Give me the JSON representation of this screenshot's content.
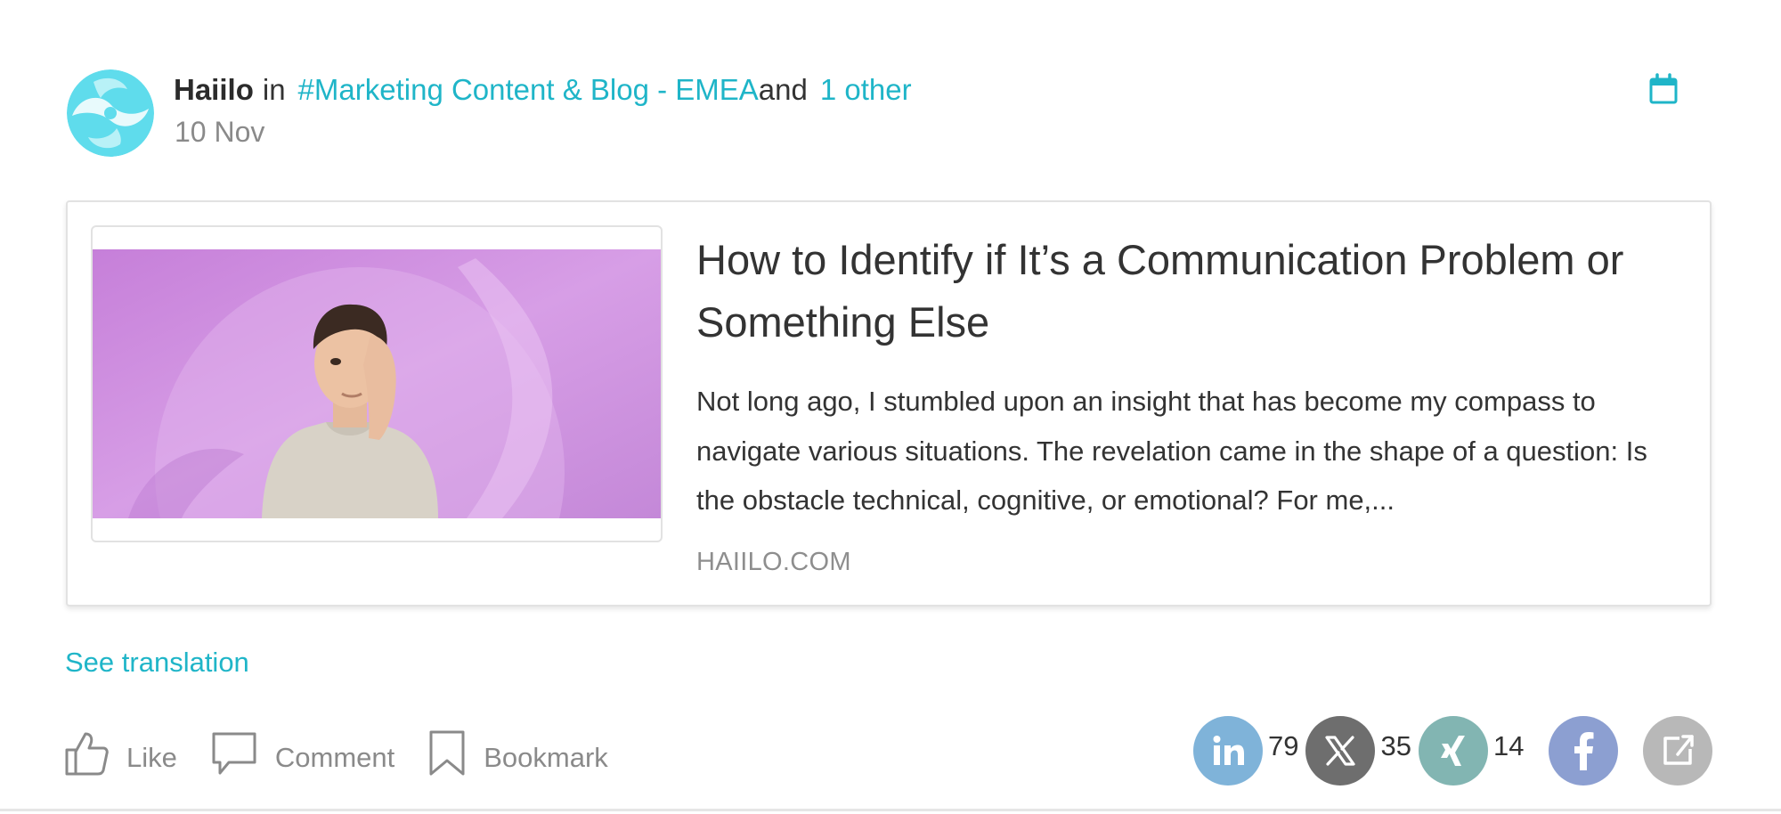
{
  "post": {
    "author": "Haiilo",
    "in_word": "in",
    "channel": "#Marketing Content & Blog - EMEA",
    "and_word": "and",
    "others": "1 other",
    "date": "10 Nov"
  },
  "preview": {
    "title": "How to Identify if It’s a Communication Problem or Something Else",
    "excerpt": "Not long ago, I stumbled upon an insight that has become my compass to navigate various situations. The revelation came in the shape of a question: Is the obstacle technical, cognitive, or emotional? For me,...",
    "domain": "HAIILO.COM"
  },
  "translation_link": "See translation",
  "actions": {
    "like": "Like",
    "comment": "Comment",
    "bookmark": "Bookmark"
  },
  "shares": {
    "linkedin": "79",
    "x": "35",
    "xing": "14"
  },
  "colors": {
    "accent": "#1fb5c8",
    "linkedin": "#7fb3d9",
    "x": "#6e6e6e",
    "xing": "#82b5b2",
    "facebook": "#8c9fd1",
    "external": "#b8b8b8"
  },
  "icons": {
    "avatar": "haiilo-logo",
    "calendar": "calendar-icon",
    "like": "thumbs-up-icon",
    "comment": "speech-bubble-icon",
    "bookmark": "bookmark-icon",
    "share_linkedin": "linkedin-icon",
    "share_x": "x-icon",
    "share_xing": "xing-icon",
    "share_facebook": "facebook-icon",
    "share_external": "external-link-icon"
  }
}
